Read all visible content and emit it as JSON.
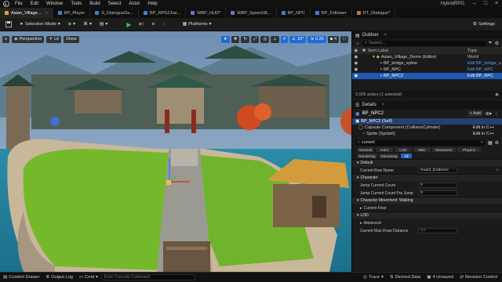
{
  "app": {
    "project_name": "HybridRPG"
  },
  "menu": [
    "File",
    "Edit",
    "Window",
    "Tools",
    "Build",
    "Select",
    "Actor",
    "Help"
  ],
  "tabs": [
    {
      "label": "Asian_Village...",
      "active": true
    },
    {
      "label": "BP_Player"
    },
    {
      "label": "S_DialogueDa..."
    },
    {
      "label": "BP_RPGChar..."
    },
    {
      "label": "WBP_HUD*"
    },
    {
      "label": "WBP_SpeechB..."
    },
    {
      "label": "BP_NPC"
    },
    {
      "label": "BP_Follower"
    },
    {
      "label": "DT_Dialogue*"
    }
  ],
  "toolbar": {
    "selection_mode": "Selection Mode",
    "platforms": "Platforms",
    "settings": "Settings"
  },
  "viewport": {
    "perspective": "Perspective",
    "lit": "Lit",
    "show": "Show",
    "snap_angle": "10°",
    "snap_scale": "0.25",
    "camera_speed": "4"
  },
  "outliner": {
    "title": "Outliner",
    "search_placeholder": "Search...",
    "col_label": "Item Label",
    "col_type": "Type",
    "rows": [
      {
        "label": "Asian_Village_Demo (Editor)",
        "type": "World",
        "indent": 1
      },
      {
        "label": "BP_bridge_spline",
        "type": "Edit BP_bridge_s",
        "indent": 2
      },
      {
        "label": "BP_NPC",
        "type": "Edit BP_NPC",
        "indent": 2
      },
      {
        "label": "BP_NPC2",
        "type": "Edit BP_NPC",
        "indent": 2,
        "selected": true
      }
    ],
    "status": "3,005 actors (1 selected)"
  },
  "details": {
    "title": "Details",
    "actor_name": "BP_NPC2",
    "add_label": "+ Add",
    "components": [
      {
        "label": "BP_NPC2 (Self)",
        "selected": true
      },
      {
        "label": "Capsule Component (CollisionCylinder)",
        "edit": "Edit in C++"
      },
      {
        "label": "Sprite (Sprite0)",
        "edit": "Edit in C++"
      }
    ],
    "search_value": "current",
    "filters_row1": [
      "General",
      "Actor",
      "LOD",
      "Misc",
      "Movement",
      "Physics"
    ],
    "filters_row2": [
      "Rendering",
      "Streaming",
      "All"
    ],
    "sections": [
      {
        "header": "Default",
        "props": [
          {
            "name": "Current Row Name",
            "value": "Guard_Evidence"
          }
        ]
      },
      {
        "header": "Character",
        "props": [
          {
            "name": "Jump Current Count",
            "value": "0"
          },
          {
            "name": "Jump Current Count Pre Jump",
            "value": "0"
          }
        ]
      },
      {
        "header": "Character Movement: Walking",
        "props": [
          {
            "name": "Current Floor",
            "value": ""
          }
        ]
      },
      {
        "header": "LOD",
        "props": [
          {
            "name": "Advanced",
            "value": ""
          },
          {
            "name": "Current Max Draw Distance",
            "value": "0.0"
          }
        ]
      }
    ]
  },
  "bottom": {
    "content_drawer": "Content Drawer",
    "output_log": "Output Log",
    "cmd": "Cmd",
    "cmd_placeholder": "Enter Console Command",
    "trace": "Trace",
    "derived_data": "Derived Data",
    "unsaved": "4 Unsaved",
    "revision_control": "Revision Control"
  }
}
